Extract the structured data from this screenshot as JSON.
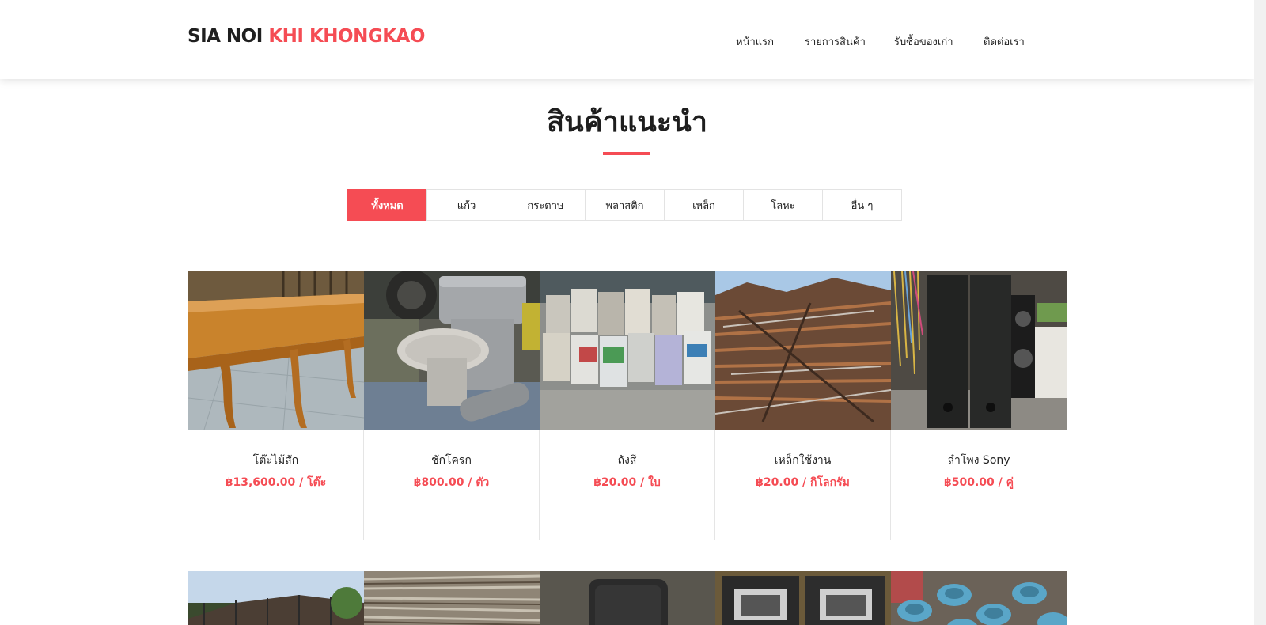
{
  "header": {
    "logo_part1": "SIA NOI",
    "logo_part2": "KHI KHONGKAO",
    "nav": [
      "หน้าแรก",
      "รายการสินค้า",
      "รับซื้อของเก่า",
      "ติดต่อเรา"
    ]
  },
  "section": {
    "title": "สินค้าแนะนำ"
  },
  "filters": [
    "ทั้งหมด",
    "แก้ว",
    "กระดาษ",
    "พลาสติก",
    "เหล็ก",
    "โลหะ",
    "อื่น ๆ"
  ],
  "active_filter": "ทั้งหมด",
  "products": [
    {
      "name": "โต๊ะไม้สัก",
      "price": "฿13,600.00 / โต๊ะ",
      "icon": "teak-table-photo"
    },
    {
      "name": "ชักโครก",
      "price": "฿800.00 / ตัว",
      "icon": "toilet-photo"
    },
    {
      "name": "ถังสี",
      "price": "฿20.00 / ใบ",
      "icon": "paint-bucket-photo"
    },
    {
      "name": "เหล็กใช้งาน",
      "price": "฿20.00 / กิโลกรัม",
      "icon": "scrap-iron-photo"
    },
    {
      "name": "ลำโพง Sony",
      "price": "฿500.00 / คู่",
      "icon": "speaker-photo"
    }
  ],
  "products_row2": [
    {
      "icon": "metal-railing-photo"
    },
    {
      "icon": "newspaper-stack-photo"
    },
    {
      "icon": "office-chair-photo"
    },
    {
      "icon": "speaker-boxes-photo"
    },
    {
      "icon": "blue-pipes-photo"
    }
  ],
  "colors": {
    "accent": "#f54c54",
    "text": "#222222",
    "border": "#e5e5e5"
  }
}
